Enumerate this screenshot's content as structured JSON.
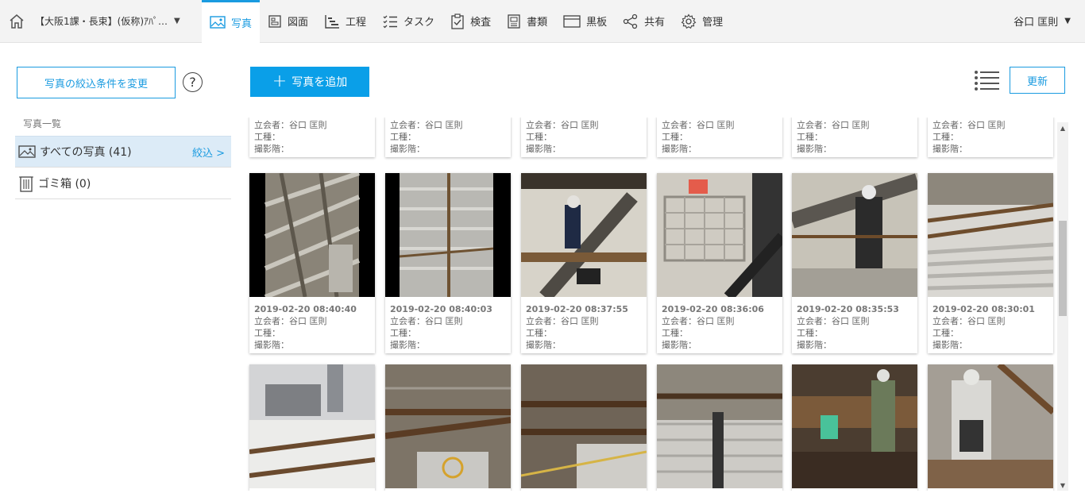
{
  "header": {
    "project_name": "【大阪1課・長束】(仮称)ｱﾊﾟ…",
    "nav": [
      {
        "label": "写真",
        "icon": "image-icon",
        "active": true
      },
      {
        "label": "図面",
        "icon": "drawing-icon"
      },
      {
        "label": "工程",
        "icon": "schedule-icon"
      },
      {
        "label": "タスク",
        "icon": "task-icon"
      },
      {
        "label": "検査",
        "icon": "inspection-icon"
      },
      {
        "label": "書類",
        "icon": "document-icon"
      },
      {
        "label": "黒板",
        "icon": "blackboard-icon"
      },
      {
        "label": "共有",
        "icon": "share-icon"
      },
      {
        "label": "管理",
        "icon": "gear-icon"
      }
    ],
    "user": "谷口 匡則"
  },
  "sidebar": {
    "filter_button": "写真の絞込条件を変更",
    "help": "?",
    "section_title": "写真一覧",
    "items": [
      {
        "label": "すべての写真 (41)",
        "action": "絞込 >"
      },
      {
        "label": "ゴミ箱 (0)"
      }
    ]
  },
  "main": {
    "add_button": "写真を追加",
    "refresh_button": "更新",
    "meta_labels": {
      "witness": "立会者：谷口 匡則",
      "work_type": "工種：",
      "floor": "撮影階："
    },
    "row2_dates": [
      "2019-02-20 08:40:40",
      "2019-02-20 08:40:03",
      "2019-02-20 08:37:55",
      "2019-02-20 08:36:06",
      "2019-02-20 08:35:53",
      "2019-02-20 08:30:01"
    ]
  },
  "colors": {
    "accent": "#1a9be0",
    "add_button": "#0a9fe8",
    "selected_row": "#dcebf7"
  }
}
